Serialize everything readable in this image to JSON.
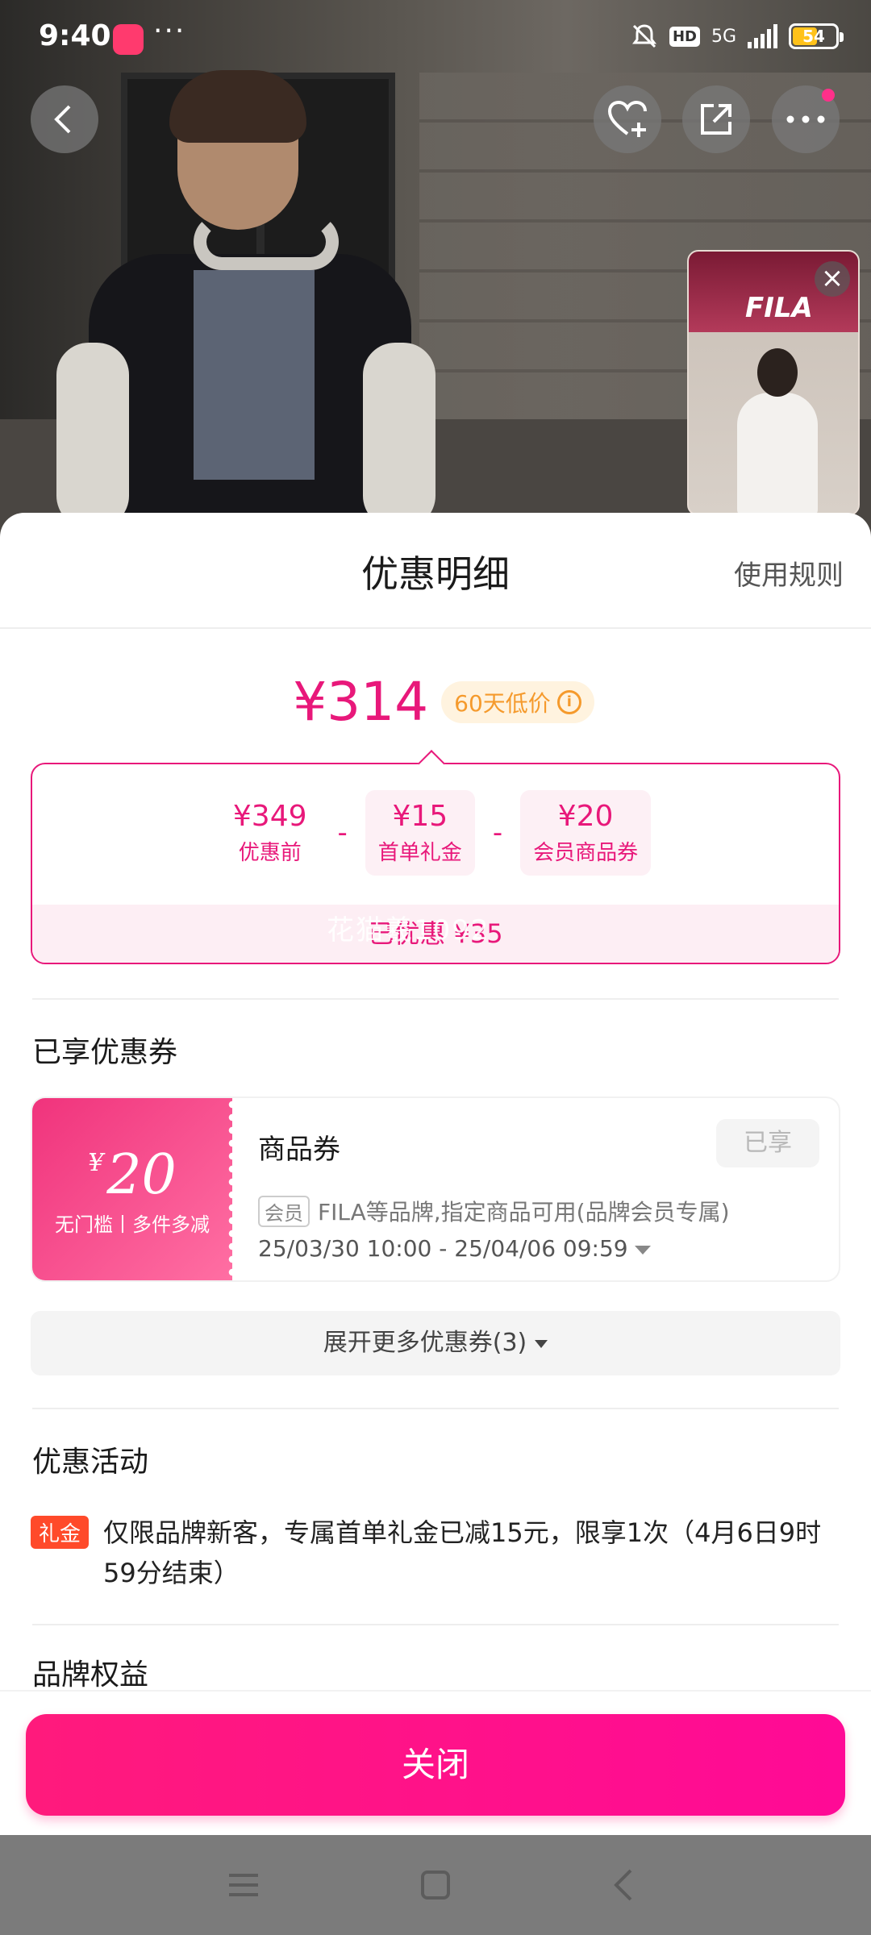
{
  "status_bar": {
    "time": "9:40",
    "more": "···",
    "hd": "HD",
    "network": "5G",
    "battery": "54"
  },
  "live_window": {
    "brand": "FILA"
  },
  "sheet": {
    "title": "优惠明细",
    "rules_link": "使用规则"
  },
  "price": {
    "final": "¥314",
    "badge": "60天低价"
  },
  "calculation": {
    "items": [
      {
        "value": "¥349",
        "label": "优惠前"
      },
      {
        "value": "¥15",
        "label": "首单礼金"
      },
      {
        "value": "¥20",
        "label": "会员商品券"
      }
    ],
    "operator": "-",
    "total": "已优惠 ¥35",
    "watermark": "花猫羲1092"
  },
  "coupons_section": {
    "title": "已享优惠券",
    "coupon": {
      "currency": "¥",
      "amount": "20",
      "condition": "无门槛丨多件多减",
      "name": "商品券",
      "status": "已享",
      "tag": "会员",
      "description": "FILA等品牌,指定商品可用(品牌会员专属)",
      "validity": "25/03/30 10:00 - 25/04/06 09:59"
    },
    "expand_label": "展开更多优惠券(3)"
  },
  "activity_section": {
    "title": "优惠活动",
    "items": [
      {
        "tag": "礼金",
        "text": "仅限品牌新客，专属首单礼金已减15元，限享1次（4月6日9时59分结束）"
      }
    ]
  },
  "brand_section": {
    "title": "品牌权益"
  },
  "close_button": "关闭",
  "colors": {
    "accent": "#e8187a",
    "close_button": "#ff0a8c",
    "low_price_badge": "#f59a2c",
    "activity_tag": "#ff4a2a"
  }
}
